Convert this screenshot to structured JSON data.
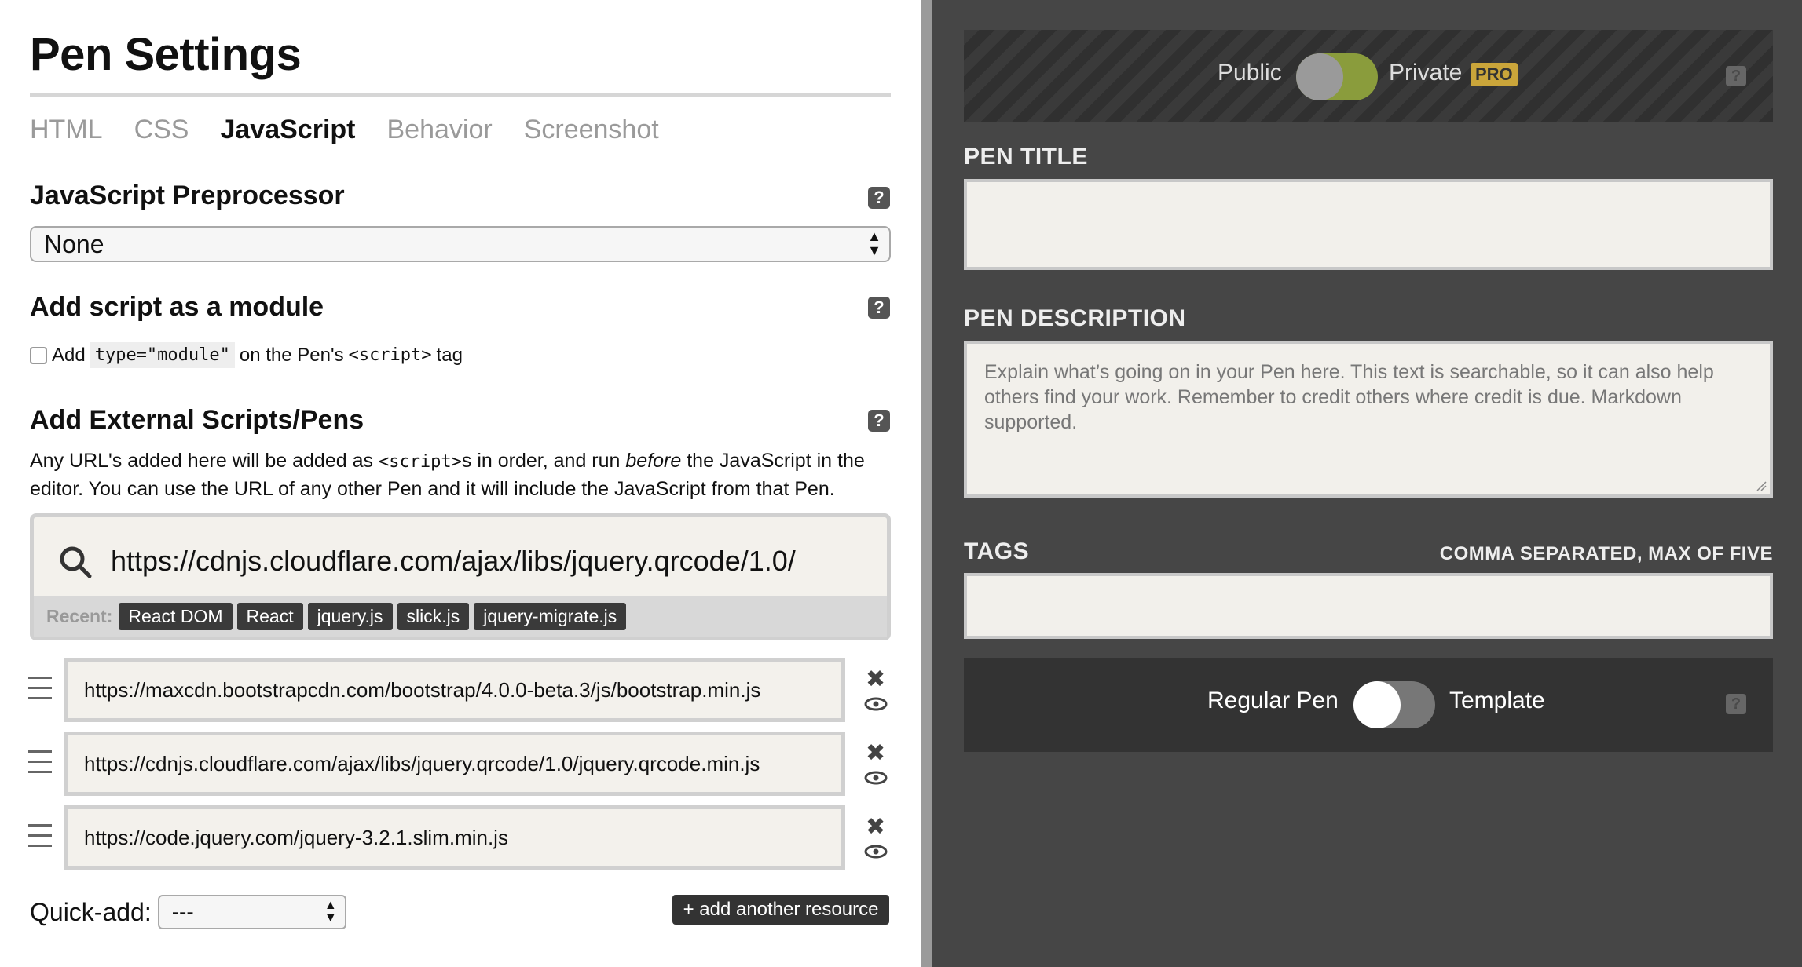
{
  "settings": {
    "title": "Pen Settings",
    "tabs": [
      "HTML",
      "CSS",
      "JavaScript",
      "Behavior",
      "Screenshot"
    ],
    "active_tab": "JavaScript"
  },
  "preprocessor": {
    "heading": "JavaScript Preprocessor",
    "selected": "None",
    "help": "?"
  },
  "module": {
    "heading": "Add script as a module",
    "help": "?",
    "checkbox_prefix": "Add",
    "code_attr": "type=\"module\"",
    "middle_text": "on the Pen's",
    "code_tag": "<script>",
    "suffix": "tag"
  },
  "external": {
    "heading": "Add External Scripts/Pens",
    "help": "?",
    "desc_1": "Any URL's added here will be added as",
    "desc_code": "<script>",
    "desc_2": "s in order, and run",
    "desc_em": "before",
    "desc_3": "the JavaScript in the editor. You can use the URL of any other Pen and it will include the JavaScript from that Pen.",
    "search_value": "https://cdnjs.cloudflare.com/ajax/libs/jquery.qrcode/1.0/",
    "recent_label": "Recent:",
    "recent": [
      "React DOM",
      "React",
      "jquery.js",
      "slick.js",
      "jquery-migrate.js"
    ],
    "resources": [
      "https://maxcdn.bootstrapcdn.com/bootstrap/4.0.0-beta.3/js/bootstrap.min.js",
      "https://cdnjs.cloudflare.com/ajax/libs/jquery.qrcode/1.0/jquery.qrcode.min.js",
      "https://code.jquery.com/jquery-3.2.1.slim.min.js"
    ],
    "close_glyph": "✖",
    "quickadd_label": "Quick-add:",
    "quickadd_value": "---",
    "add_button": "+ add another resource"
  },
  "privacy": {
    "public_label": "Public",
    "private_label": "Private",
    "pro_badge": "PRO",
    "help": "?"
  },
  "details": {
    "title_label": "PEN TITLE",
    "title_value": "",
    "desc_label": "PEN DESCRIPTION",
    "desc_placeholder": "Explain what’s going on in your Pen here. This text is searchable, so it can also help others find your work. Remember to credit others where credit is due. Markdown supported.",
    "tags_label": "TAGS",
    "tags_hint": "COMMA SEPARATED, MAX OF FIVE",
    "tags_value": ""
  },
  "template": {
    "regular_label": "Regular Pen",
    "template_label": "Template",
    "help": "?"
  }
}
